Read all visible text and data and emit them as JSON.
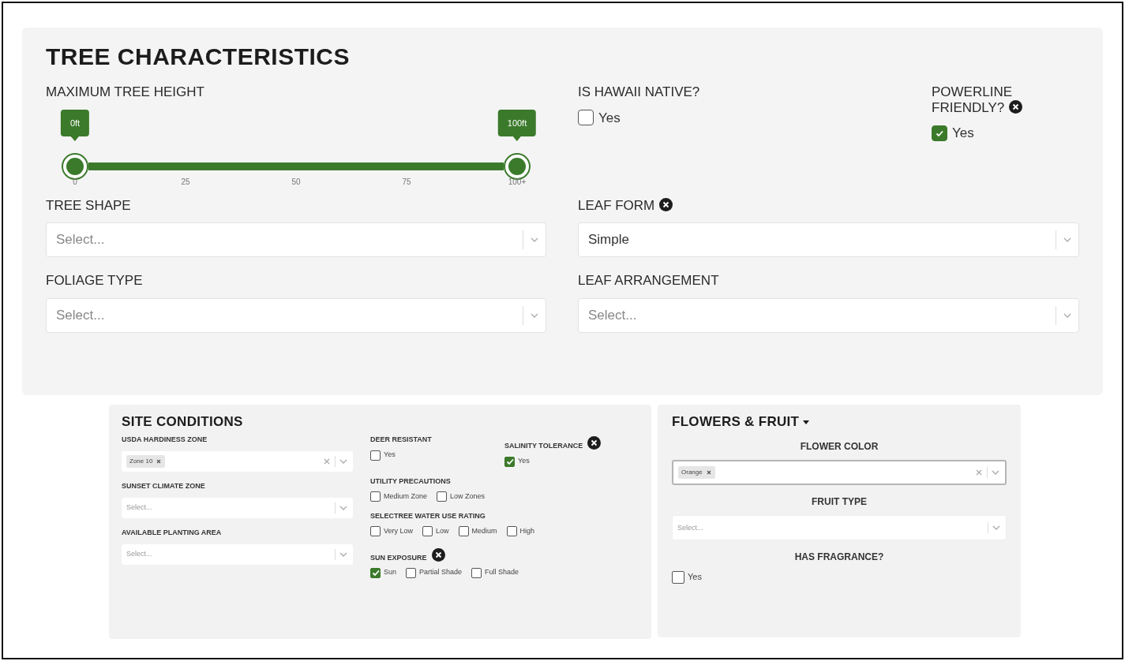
{
  "tree_characteristics": {
    "title": "TREE CHARACTERISTICS",
    "height_filter": {
      "label": "MAXIMUM TREE HEIGHT",
      "handles": [
        {
          "label": "0ft"
        },
        {
          "label": "100ft"
        }
      ],
      "ticks": [
        "0",
        "25",
        "50",
        "75",
        "100+"
      ]
    },
    "checkbox_filters": [
      {
        "label": "IS HAWAII NATIVE?",
        "info": false,
        "options": [
          {
            "label": "Yes",
            "checked": false
          }
        ]
      },
      {
        "label": "POWERLINE FRIENDLY?",
        "info": true,
        "options": [
          {
            "label": "Yes",
            "checked": true
          }
        ]
      }
    ],
    "selects": [
      {
        "label": "TREE SHAPE",
        "info": false,
        "placeholder": "Select..."
      },
      {
        "label": "LEAF FORM",
        "info": true,
        "value": "Simple"
      },
      {
        "label": "FOLIAGE TYPE",
        "info": false,
        "placeholder": "Select..."
      },
      {
        "label": "LEAF ARRANGEMENT",
        "info": false,
        "placeholder": "Select..."
      }
    ]
  },
  "site_conditions": {
    "title": "SITE CONDITIONS",
    "selects": [
      {
        "label": "USDA HARDINESS ZONE",
        "tags": [
          "Zone 10"
        ],
        "clearable": true
      },
      {
        "label": "SUNSET CLIMATE ZONE",
        "placeholder": "Select..."
      },
      {
        "label": "AVAILABLE PLANTING AREA",
        "placeholder": "Select..."
      }
    ],
    "checkbox_rows": [
      [
        {
          "label": "DEER RESISTANT",
          "info": false,
          "options": [
            {
              "label": "Yes",
              "checked": false
            }
          ]
        },
        {
          "label": "SALINITY TOLERANCE",
          "info": true,
          "options": [
            {
              "label": "Yes",
              "checked": true
            }
          ]
        }
      ],
      [
        {
          "label": "UTILITY PRECAUTIONS",
          "info": false,
          "options": [
            {
              "label": "Medium Zone",
              "checked": false
            },
            {
              "label": "Low Zones",
              "checked": false
            }
          ]
        }
      ],
      [
        {
          "label": "SELECTREE WATER USE RATING",
          "info": false,
          "options": [
            {
              "label": "Very Low",
              "checked": false
            },
            {
              "label": "Low",
              "checked": false
            },
            {
              "label": "Medium",
              "checked": false
            },
            {
              "label": "High",
              "checked": false
            }
          ]
        }
      ],
      [
        {
          "label": "SUN EXPOSURE",
          "info": true,
          "options": [
            {
              "label": "Sun",
              "checked": true
            },
            {
              "label": "Partial Shade",
              "checked": false
            },
            {
              "label": "Full Shade",
              "checked": false
            }
          ]
        }
      ]
    ]
  },
  "flowers_fruit": {
    "title": "FLOWERS & FRUIT",
    "fields": [
      {
        "kind": "select",
        "label": "FLOWER COLOR",
        "tags": [
          "Orange"
        ],
        "clearable": true,
        "focused": true
      },
      {
        "kind": "select",
        "label": "FRUIT TYPE",
        "placeholder": "Select...",
        "focused": false
      },
      {
        "kind": "checkbox",
        "label": "HAS FRAGRANCE?",
        "options": [
          {
            "label": "Yes",
            "checked": false
          }
        ]
      }
    ]
  }
}
